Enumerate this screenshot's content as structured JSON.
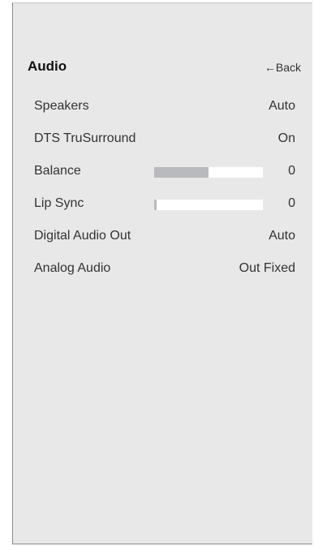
{
  "header": {
    "title": "Audio",
    "back_label": "←Back"
  },
  "menu": {
    "items": [
      {
        "label": "Speakers",
        "value": "Auto"
      },
      {
        "label": "DTS TruSurround",
        "value": "On"
      },
      {
        "label": "Balance",
        "value": "0",
        "slider_fill": 0.5
      },
      {
        "label": "Lip Sync",
        "value": "0",
        "slider_fill": 0.02
      },
      {
        "label": "Digital Audio Out",
        "value": "Auto"
      },
      {
        "label": "Analog Audio",
        "value": "Out Fixed"
      }
    ]
  },
  "colors": {
    "panel_bg": "#e8e8e8",
    "slider_fill": "#b8babd",
    "slider_track": "#ffffff"
  }
}
